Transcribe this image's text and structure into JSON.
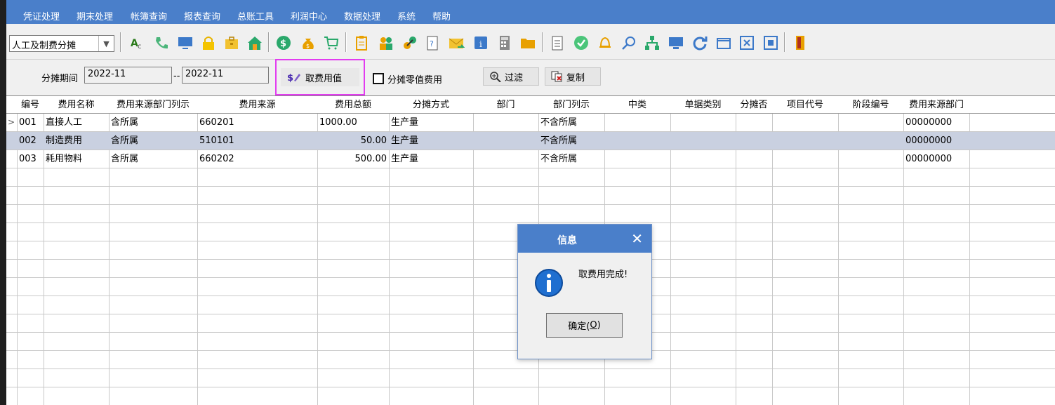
{
  "menu": [
    "凭证处理",
    "期末处理",
    "帐簿查询",
    "报表查询",
    "总账工具",
    "利润中心",
    "数据处理",
    "系统",
    "帮助"
  ],
  "toolbar": {
    "module_select_value": "人工及制费分摊",
    "icons": [
      "abc-icon",
      "phone-icon",
      "monitor-icon",
      "lock-icon",
      "briefcase-icon",
      "home-icon",
      "dollar-icon",
      "money-bag-icon",
      "cart-icon",
      "clipboard-icon",
      "users-icon",
      "link-icon",
      "help-doc-icon",
      "mail-icon",
      "info-icon",
      "calculator-icon",
      "folder-icon",
      "document-icon",
      "check-circle-icon",
      "bell-icon",
      "search-icon",
      "org-chart-icon",
      "display-icon",
      "refresh-icon",
      "window-icon",
      "close-icon",
      "restore-icon",
      "exit-door-icon"
    ]
  },
  "filter": {
    "period_label": "分摊期间",
    "period_from": "2022-11",
    "separator": "--",
    "period_to": "2022-11",
    "fetch_button": "取费用值",
    "zero_checkbox_label": "分摊零值费用",
    "filter_button": "过滤",
    "copy_button": "复制"
  },
  "table": {
    "columns": [
      "编号",
      "费用名称",
      "费用来源部门列示",
      "费用来源",
      "费用总额",
      "分摊方式",
      "部门",
      "部门列示",
      "中类",
      "单据类别",
      "分摊否",
      "项目代号",
      "阶段编号",
      "费用来源部门"
    ],
    "rows": [
      [
        "001",
        "直接人工",
        "含所属",
        "660201",
        "1000.00",
        "生产量",
        "",
        "不含所属",
        "",
        "",
        "",
        "",
        "",
        "00000000"
      ],
      [
        "002",
        "制造费用",
        "含所属",
        "510101",
        "50.00",
        "生产量",
        "",
        "不含所属",
        "",
        "",
        "",
        "",
        "",
        "00000000"
      ],
      [
        "003",
        "耗用物料",
        "含所属",
        "660202",
        "500.00",
        "生产量",
        "",
        "不含所属",
        "",
        "",
        "",
        "",
        "",
        "00000000"
      ]
    ],
    "current_row_marker": ">"
  },
  "dialog": {
    "title": "信息",
    "message": "取费用完成!",
    "ok_button": "确定(",
    "ok_hotkey": "O",
    "ok_close": ")"
  }
}
